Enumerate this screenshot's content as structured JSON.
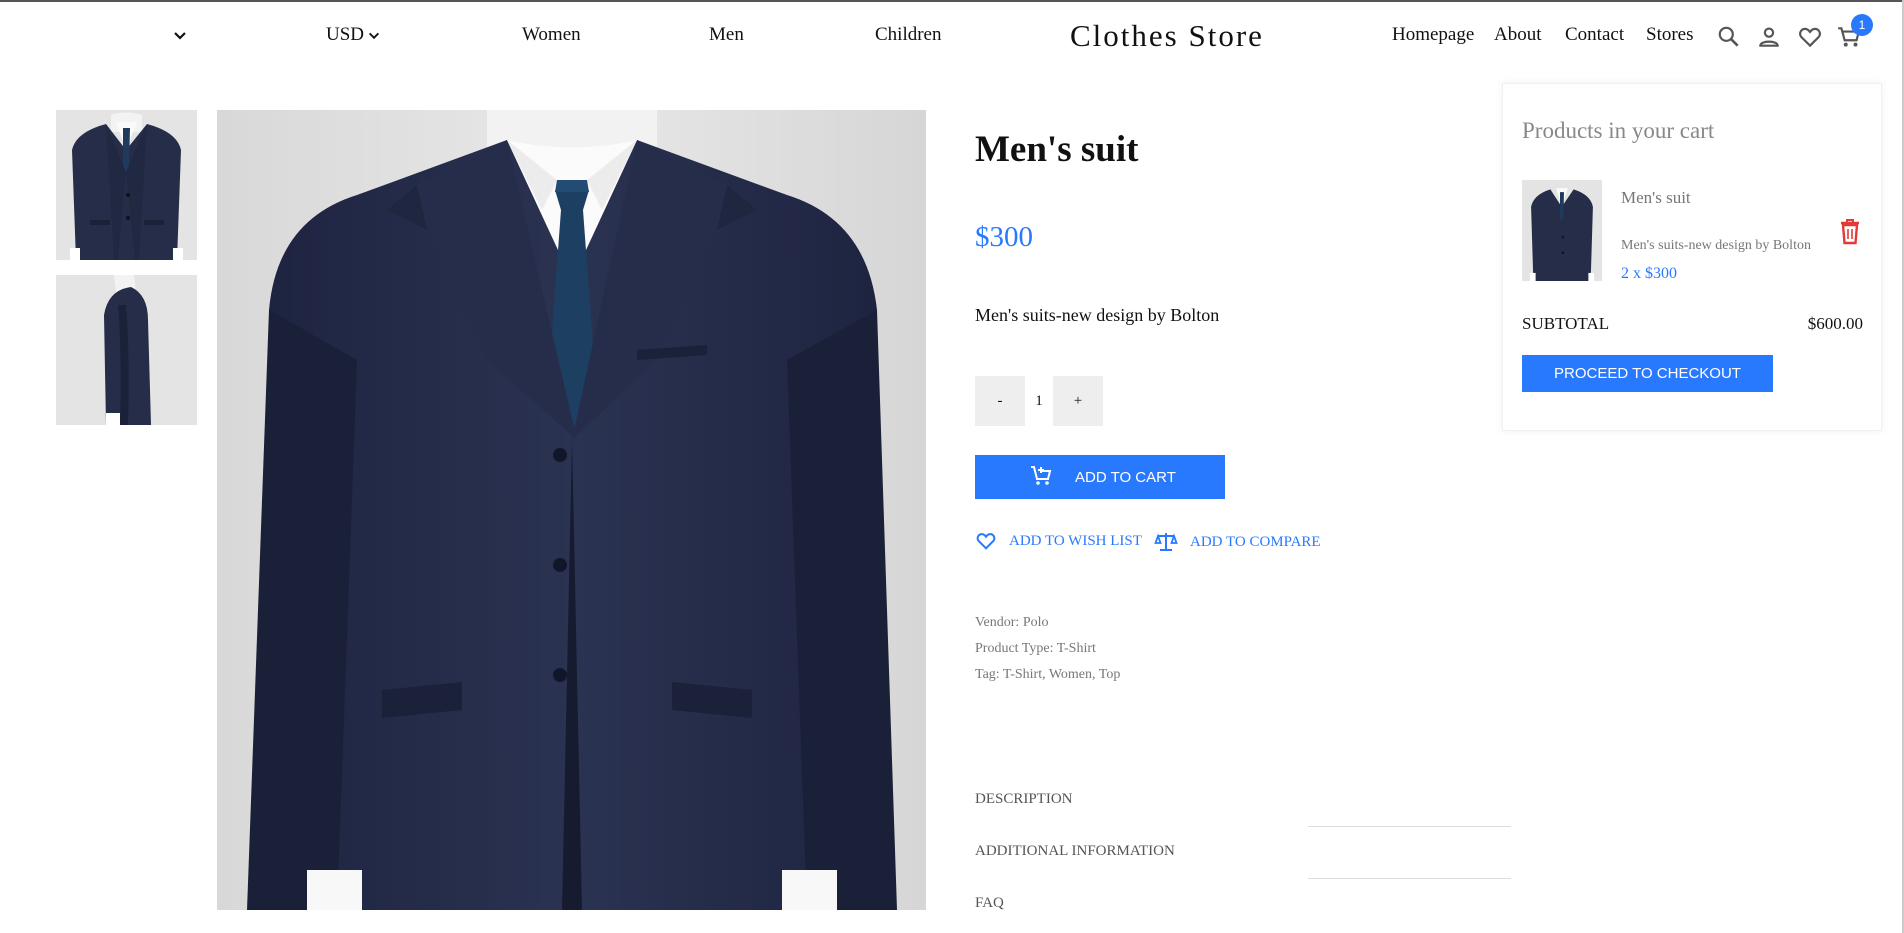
{
  "header": {
    "currency": "USD",
    "nav_left": [
      "Women",
      "Men",
      "Children"
    ],
    "logo": "Clothes Store",
    "nav_right": [
      "Homepage",
      "About",
      "Contact",
      "Stores"
    ],
    "cart_count": "1",
    "icons": [
      "chevron-down-icon",
      "search-icon",
      "user-icon",
      "heart-icon",
      "cart-icon"
    ]
  },
  "product": {
    "title": "Men's suit",
    "price": "$300",
    "description": "Men's suits-new design by Bolton",
    "quantity": "1",
    "minus_label": "-",
    "plus_label": "+",
    "add_to_cart": "ADD TO CART",
    "add_to_wishlist": "ADD TO WISH LIST",
    "add_to_compare": "ADD TO COMPARE",
    "vendor": "Vendor: Polo",
    "product_type": "Product Type: T-Shirt",
    "tags": "Tag: T-Shirt, Women, Top",
    "tabs": [
      "DESCRIPTION",
      "ADDITIONAL INFORMATION",
      "FAQ"
    ]
  },
  "cart": {
    "heading": "Products in your cart",
    "item": {
      "name": "Men's suit",
      "description": "Men's suits-new design by Bolton",
      "qty_price": "2 x $300"
    },
    "subtotal_label": "SUBTOTAL",
    "subtotal_value": "$600.00",
    "checkout_label": "PROCEED TO CHECKOUT"
  },
  "colors": {
    "accent": "#2979ff",
    "delete": "#e53935",
    "suit": "#262d48"
  }
}
